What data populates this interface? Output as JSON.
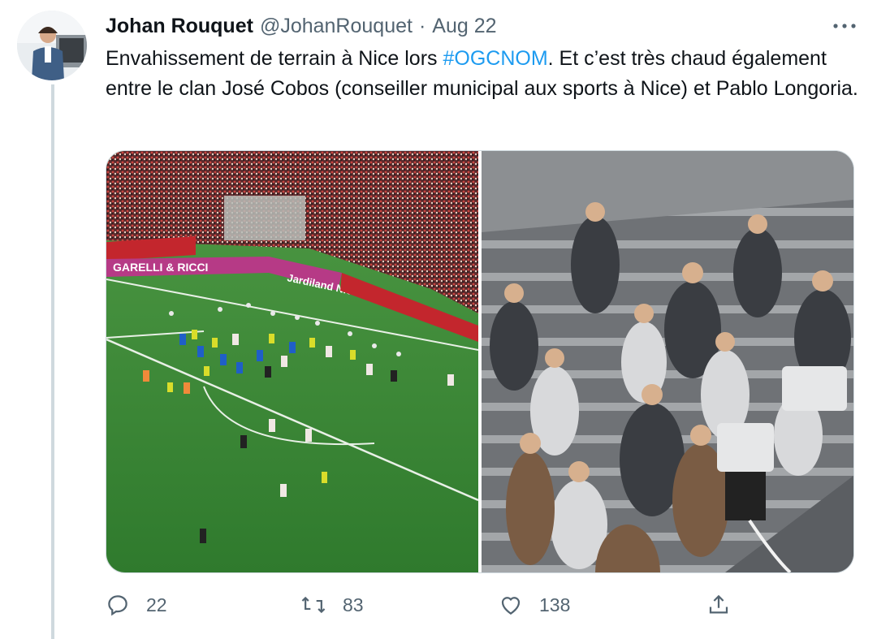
{
  "tweet": {
    "author_name": "Johan Rouquet",
    "handle": "@JohanRouquet",
    "separator": "·",
    "date": "Aug 22",
    "text_before": "Envahissement de terrain à Nice lors ",
    "hashtag": "#OGCNOM",
    "text_after": ". Et c’est très chaud également entre le clan José Cobos (conseiller municipal aux sports à Nice) et Pablo Longoria.",
    "photo_ad_text_1": "GARELLI & RICCI",
    "photo_ad_text_2": "Jardiland Nice"
  },
  "actions": {
    "reply_count": "22",
    "retweet_count": "83",
    "like_count": "138"
  },
  "icons": {
    "reply": "reply-icon",
    "retweet": "retweet-icon",
    "like": "like-icon",
    "share": "share-icon",
    "more": "more-icon"
  },
  "colors": {
    "text": "#0f1419",
    "secondary": "#536471",
    "link": "#1d9bf0",
    "pitch": "#3f8a3a",
    "crowd_red": "#b3262c"
  }
}
